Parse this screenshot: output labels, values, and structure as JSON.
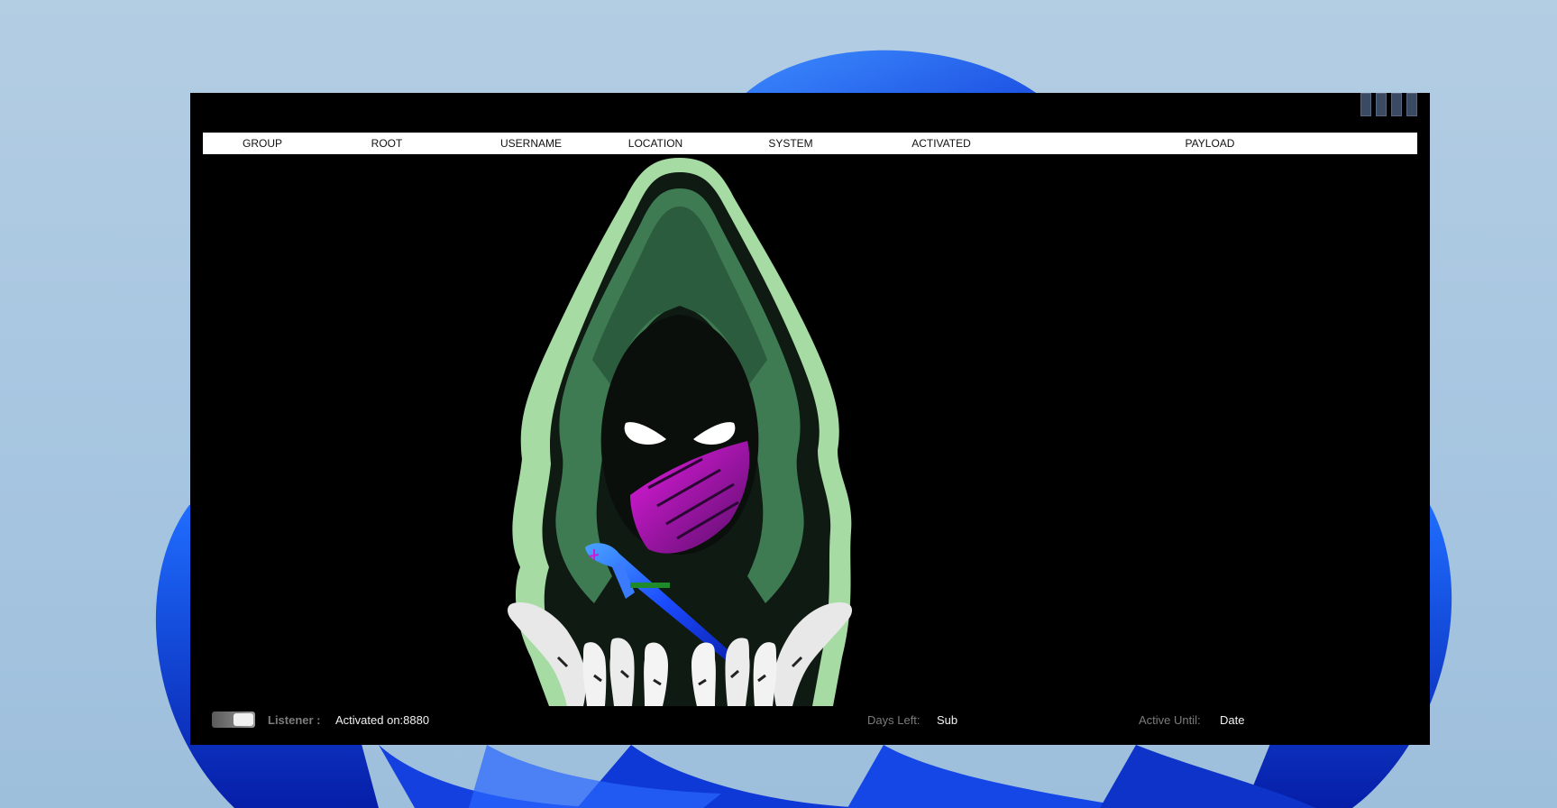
{
  "window": {
    "controls": [
      "window-control-1",
      "window-control-2",
      "window-control-3",
      "window-control-4"
    ]
  },
  "table": {
    "columns": [
      "GROUP",
      "ROOT",
      "USERNAME",
      "LOCATION",
      "SYSTEM",
      "ACTIVATED",
      "PAYLOAD"
    ],
    "rows": []
  },
  "status": {
    "listener_label": "Listener :",
    "listener_value": "Activated on:8880",
    "days_left_label": "Days Left:",
    "days_left_value": "Sub",
    "active_until_label": "Active Until:",
    "active_until_value": "Date",
    "listener_toggle_on": true
  },
  "colors": {
    "window_bg": "#000000",
    "header_bg": "#ffffff",
    "hood_outline": "#a6dca4",
    "hood_dark": "#2e5a3c",
    "accent_blue": "#1f5cff",
    "accent_magenta": "#c81ed6"
  }
}
